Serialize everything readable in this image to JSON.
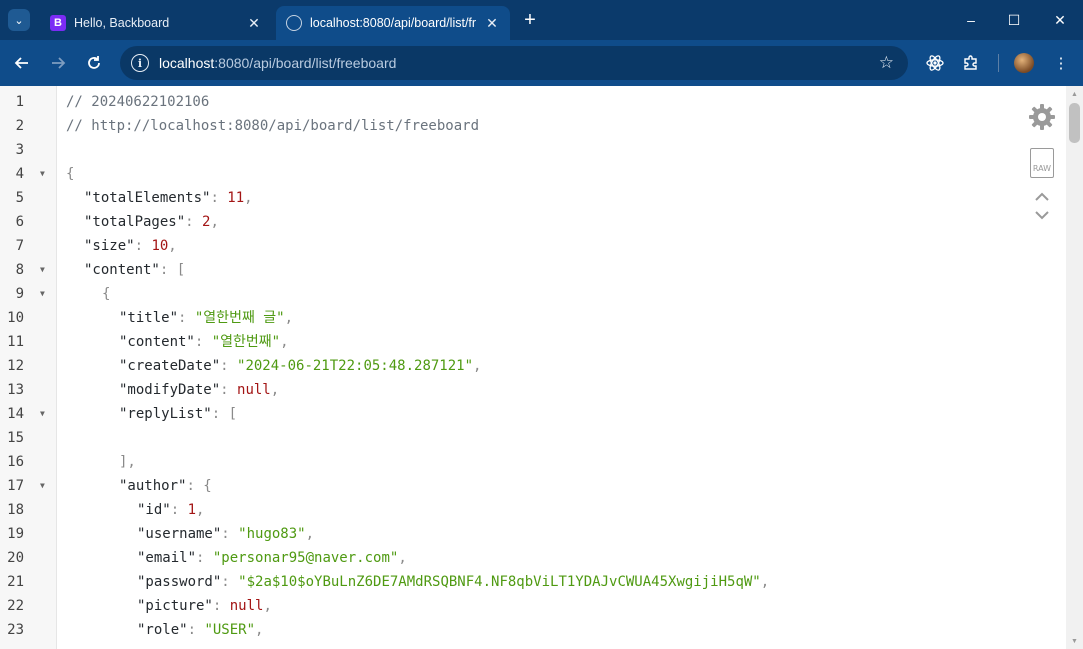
{
  "browser": {
    "tabs": [
      {
        "title": "Hello, Backboard",
        "favicon": "B",
        "active": false
      },
      {
        "title": "localhost:8080/api/board/list/fr",
        "favicon": "globe",
        "active": true
      }
    ],
    "new_tab_label": "+",
    "window_controls": {
      "minimize": "–",
      "maximize": "☐",
      "close": "✕"
    },
    "address": {
      "host": "localhost",
      "path": ":8080/api/board/list/freeboard"
    }
  },
  "viewer": {
    "lines": [
      {
        "n": "1",
        "fold": false
      },
      {
        "n": "2",
        "fold": false
      },
      {
        "n": "3",
        "fold": false
      },
      {
        "n": "4",
        "fold": true
      },
      {
        "n": "5",
        "fold": false
      },
      {
        "n": "6",
        "fold": false
      },
      {
        "n": "7",
        "fold": false
      },
      {
        "n": "8",
        "fold": true
      },
      {
        "n": "9",
        "fold": true
      },
      {
        "n": "10",
        "fold": false
      },
      {
        "n": "11",
        "fold": false
      },
      {
        "n": "12",
        "fold": false
      },
      {
        "n": "13",
        "fold": false
      },
      {
        "n": "14",
        "fold": true
      },
      {
        "n": "15",
        "fold": false
      },
      {
        "n": "16",
        "fold": false
      },
      {
        "n": "17",
        "fold": true
      },
      {
        "n": "18",
        "fold": false
      },
      {
        "n": "19",
        "fold": false
      },
      {
        "n": "20",
        "fold": false
      },
      {
        "n": "21",
        "fold": false
      },
      {
        "n": "22",
        "fold": false
      },
      {
        "n": "23",
        "fold": false
      }
    ],
    "code": {
      "l1": "// 20240622102106",
      "l2": "// http://localhost:8080/api/board/list/freeboard",
      "l4_brace": "{",
      "totalElements_key": "\"totalElements\"",
      "totalElements_val": "11",
      "totalPages_key": "\"totalPages\"",
      "totalPages_val": "2",
      "size_key": "\"size\"",
      "size_val": "10",
      "content_key": "\"content\"",
      "bracket_open": "[",
      "l9_brace": "{",
      "title_key": "\"title\"",
      "title_val": "\"열한번째 글\"",
      "content2_key": "\"content\"",
      "content2_val": "\"열한번째\"",
      "createDate_key": "\"createDate\"",
      "createDate_val": "\"2024-06-21T22:05:48.287121\"",
      "modifyDate_key": "\"modifyDate\"",
      "modifyDate_val": "null",
      "replyList_key": "\"replyList\"",
      "replyList_open": "[",
      "replyList_close": "],",
      "author_key": "\"author\"",
      "author_open": "{",
      "id_key": "\"id\"",
      "id_val": "1",
      "username_key": "\"username\"",
      "username_val": "\"hugo83\"",
      "email_key": "\"email\"",
      "email_val": "\"personar95@naver.com\"",
      "password_key": "\"password\"",
      "password_val": "\"$2a$10$oYBuLnZ6DE7AMdRSQBNF4.NF8qbViLT1YDAJvCWUA45XwgijiH5qW\"",
      "picture_key": "\"picture\"",
      "picture_val": "null",
      "role_key": "\"role\"",
      "role_val": "\"USER\""
    },
    "tools": {
      "raw_label": "RAW"
    }
  }
}
